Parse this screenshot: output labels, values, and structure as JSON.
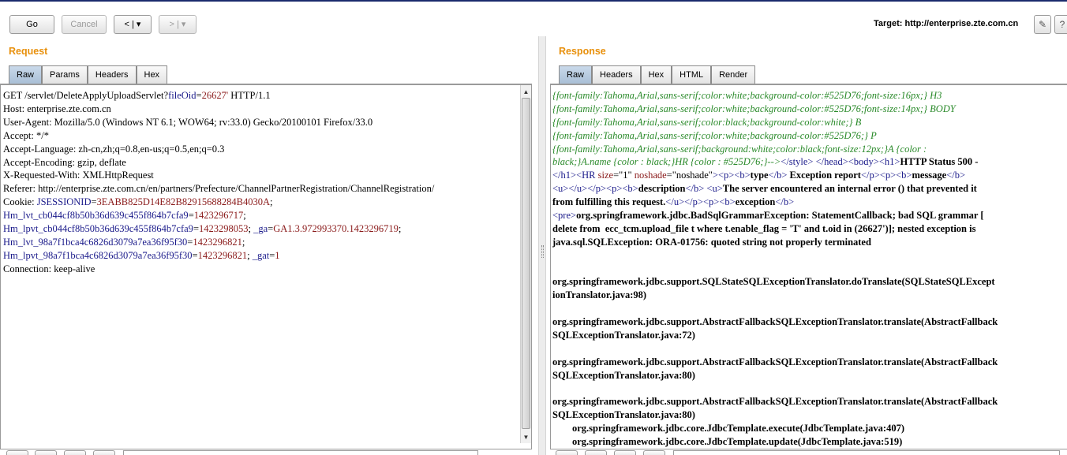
{
  "toolbar": {
    "go_label": "Go",
    "cancel_label": "Cancel",
    "back_label": "< | ▾",
    "forward_label": "> | ▾",
    "target_prefix": "Target: ",
    "target_url": "http://enterprise.zte.com.cn",
    "edit_icon": "pencil-icon",
    "help_icon": "help-icon"
  },
  "request": {
    "title": "Request",
    "tabs": [
      "Raw",
      "Params",
      "Headers",
      "Hex"
    ],
    "active_tab": "Raw",
    "line1_a": "GET /servlet/DeleteApplyUploadServlet?",
    "line1_k": "fileOid",
    "line1_eq": "=",
    "line1_v": "26627'",
    "line1_b": " HTTP/1.1",
    "host": "Host: enterprise.zte.com.cn",
    "user_agent": "User-Agent: Mozilla/5.0 (Windows NT 6.1; WOW64; rv:33.0) Gecko/20100101 Firefox/33.0",
    "accept": "Accept: */*",
    "accept_language": "Accept-Language: zh-cn,zh;q=0.8,en-us;q=0.5,en;q=0.3",
    "accept_encoding": "Accept-Encoding: gzip, deflate",
    "x_requested_with": "X-Requested-With: XMLHttpRequest",
    "referer": "Referer: http://enterprise.zte.com.cn/en/partners/Prefecture/ChannelPartnerRegistration/ChannelRegistration/",
    "cookie_prefix": "Cookie: ",
    "c1k": "JSESSIONID",
    "c1v": "3EABB825D14E82B82915688284B4030A",
    "c2k": "Hm_lvt_cb044cf8b50b36d639c455f864b7cfa9",
    "c2v": "1423296717",
    "c3k": "Hm_lpvt_cb044cf8b50b36d639c455f864b7cfa9",
    "c3v": "1423298053",
    "c4k": "_ga",
    "c4v": "GA1.3.972993370.1423296719",
    "c5k": "Hm_lvt_98a7f1bca4c6826d3079a7ea36f95f30",
    "c5v": "1423296821",
    "c6k": "Hm_lpvt_98a7f1bca4c6826d3079a7ea36f95f30",
    "c6v": "1423296821",
    "c7k": "_gat",
    "c7v": "1",
    "connection": "Connection: keep-alive"
  },
  "response": {
    "title": "Response",
    "tabs": [
      "Raw",
      "Headers",
      "Hex",
      "HTML",
      "Render"
    ],
    "active_tab": "Raw",
    "css1": "{font-family:Tahoma,Arial,sans-serif;color:white;background-color:#525D76;font-size:16px;} H3",
    "css2": "{font-family:Tahoma,Arial,sans-serif;color:white;background-color:#525D76;font-size:14px;} BODY",
    "css3": "{font-family:Tahoma,Arial,sans-serif;color:black;background-color:white;} B",
    "css4": "{font-family:Tahoma,Arial,sans-serif;color:white;background-color:#525D76;} P",
    "css5": "{font-family:Tahoma,Arial,sans-serif;background:white;color:black;font-size:12px;}A {color :",
    "css6": "black;}A.name {color : black;}HR {color : #525D76;}-->",
    "l6_style": "</style>",
    "l6_head": " </head>",
    "l6_body": "<body>",
    "l6_h1": "<h1>",
    "l6_status": "HTTP Status 500 -",
    "l7_h1c": "</h1>",
    "l7_hr": "<HR ",
    "l7_size_k": "size",
    "l7_size_v": "=\"1\" ",
    "l7_ns_k": "noshade",
    "l7_ns_v": "=\"noshade\"",
    "l7_gt": ">",
    "l7_p": "<p>",
    "l7_b": "<b>",
    "l7_type": "type",
    "l7_bc": "</b>",
    "l7_er": " Exception report",
    "l7_pc": "</p>",
    "l7_p2": "<p>",
    "l7_b2": "<b>",
    "l7_msg": "message",
    "l7_bc2": "</b>",
    "l8_u": "<u>",
    "l8_uc": "</u>",
    "l8_pc": "</p>",
    "l8_p": "<p>",
    "l8_b": "<b>",
    "l8_desc": "description",
    "l8_bc": "</b>",
    "l8_u2": " <u>",
    "l8_text": "The server encountered an internal error () that prevented it",
    "l9_text": "from fulfilling this request.",
    "l9_uc": "</u>",
    "l9_pc": "</p>",
    "l9_p": "<p>",
    "l9_b": "<b>",
    "l9_exc": "exception",
    "l9_bc": "</b>",
    "l10_pre": "<pre>",
    "l10_text": "org.springframework.jdbc.BadSqlGrammarException: StatementCallback; bad SQL grammar [",
    "l11_text": "delete from  ecc_tcm.upload_file t where t.enable_flag = 'T' and t.oid in (26627')]; nested exception is",
    "l12_text": "java.sql.SQLException: ORA-01756: quoted string not properly terminated",
    "st1a": "org.springframework.jdbc.support.SQLStateSQLExceptionTranslator.doTranslate(SQLStateSQLExcept",
    "st1b": "ionTranslator.java:98)",
    "st2a": "org.springframework.jdbc.support.AbstractFallbackSQLExceptionTranslator.translate(AbstractFallback",
    "st2b": "SQLExceptionTranslator.java:72)",
    "st3a": "org.springframework.jdbc.support.AbstractFallbackSQLExceptionTranslator.translate(AbstractFallback",
    "st3b": "SQLExceptionTranslator.java:80)",
    "st4a": "org.springframework.jdbc.support.AbstractFallbackSQLExceptionTranslator.translate(AbstractFallback",
    "st4b": "SQLExceptionTranslator.java:80)",
    "st5": "        org.springframework.jdbc.core.JdbcTemplate.execute(JdbcTemplate.java:407)",
    "st6": "        org.springframework.jdbc.core.JdbcTemplate.update(JdbcTemplate.java:519)"
  }
}
